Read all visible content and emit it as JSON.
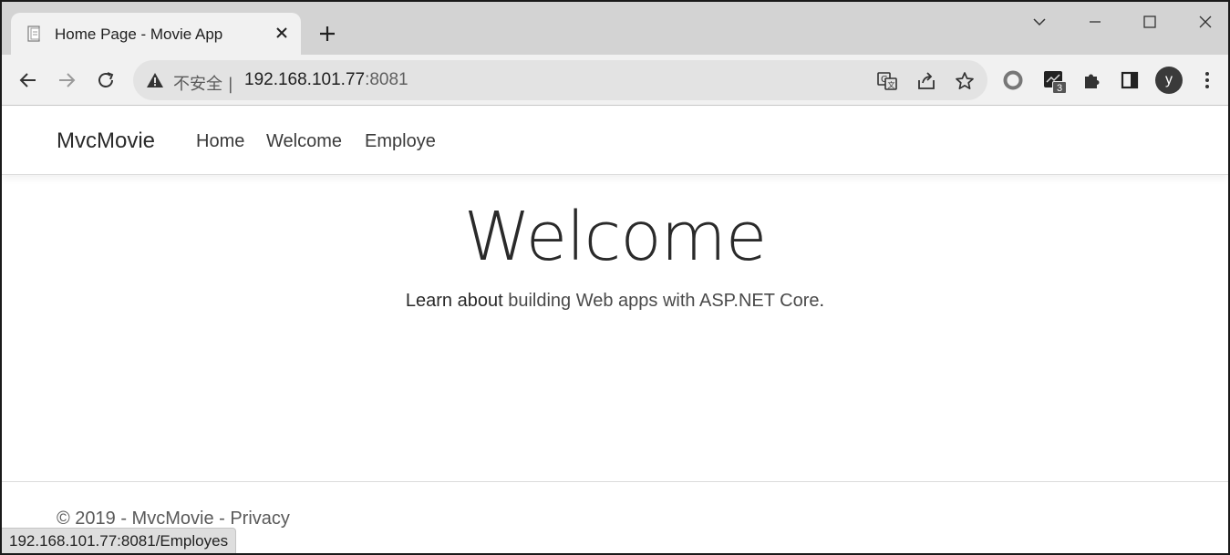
{
  "browser": {
    "tab": {
      "title": "Home Page - Movie App"
    },
    "toolbar": {
      "security_label": "不安全",
      "url_host": "192.168.101.77",
      "url_port": ":8081",
      "extension_badge": "3",
      "profile_initial": "y"
    },
    "status_url": "192.168.101.77:8081/Employes"
  },
  "navbar": {
    "brand": "MvcMovie",
    "links": [
      "Home",
      "Welcome",
      "Employe"
    ]
  },
  "hero": {
    "title": "Welcome",
    "text_prefix": "Learn about ",
    "link_text": "building Web apps with ASP.NET Core",
    "text_suffix": "."
  },
  "footer": {
    "text": "© 2019 - MvcMovie - ",
    "privacy_link": "Privacy"
  },
  "icons": {
    "favicon": "document-icon",
    "security": "warning-icon",
    "translate": "translate-icon",
    "share": "share-icon",
    "bookmark": "star-icon"
  }
}
